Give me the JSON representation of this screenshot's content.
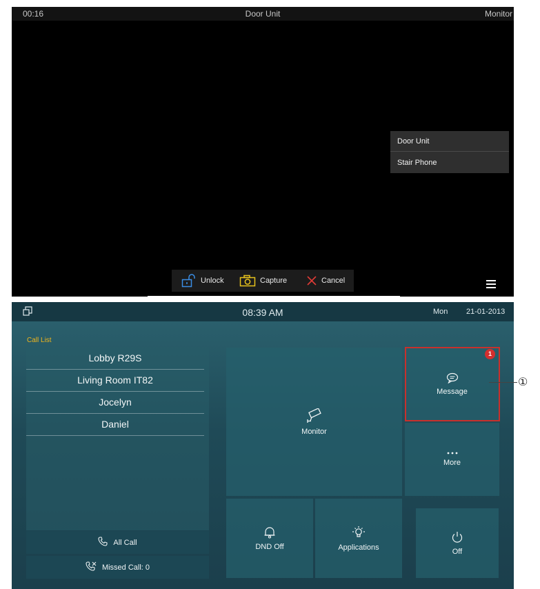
{
  "monitor": {
    "timer": "00:16",
    "title": "Door Unit",
    "mode": "Monitor",
    "source_menu": [
      "Door Unit",
      "Stair Phone"
    ],
    "toolbar": {
      "unlock": "Unlock",
      "capture": "Capture",
      "cancel": "Cancel"
    }
  },
  "home": {
    "status": {
      "time": "08:39 AM",
      "day": "Mon",
      "date": "21-01-2013"
    },
    "call_list": {
      "label": "Call List",
      "contacts": [
        "Lobby R29S",
        "Living Room IT82",
        "Jocelyn",
        "Daniel"
      ],
      "all_call": "All Call",
      "missed_call": "Missed Call: 0"
    },
    "tiles": {
      "monitor": "Monitor",
      "message": "Message",
      "message_badge": "1",
      "more": "More",
      "dnd": "DND Off",
      "applications": "Applications",
      "off": "Off"
    }
  },
  "annotation": {
    "callout": "①"
  },
  "colors": {
    "accent_label": "#f0b51c",
    "highlight": "#c9302c",
    "badge": "#d32f2f",
    "tile": "#265f6c",
    "background": "#1f4a57"
  }
}
